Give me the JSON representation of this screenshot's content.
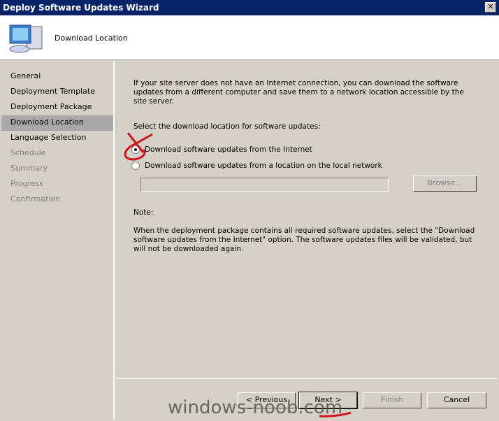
{
  "window": {
    "title": "Deploy Software Updates Wizard",
    "close": "✕"
  },
  "header": {
    "title": "Download Location",
    "icon": "computer-icon"
  },
  "sidebar": {
    "items": [
      {
        "label": "General",
        "state": "normal"
      },
      {
        "label": "Deployment Template",
        "state": "normal"
      },
      {
        "label": "Deployment Package",
        "state": "normal"
      },
      {
        "label": "Download Location",
        "state": "active"
      },
      {
        "label": "Language Selection",
        "state": "normal"
      },
      {
        "label": "Schedule",
        "state": "disabled"
      },
      {
        "label": "Summary",
        "state": "disabled"
      },
      {
        "label": "Progress",
        "state": "disabled"
      },
      {
        "label": "Confirmation",
        "state": "disabled"
      }
    ]
  },
  "main": {
    "intro": "If your site server does not have an Internet connection, you can download the software updates from a different computer and save them to a network location accessible by the site server.",
    "select_label": "Select the download location for software updates:",
    "option_internet": "Download software updates from the Internet",
    "option_network": "Download software updates from a location on the local network",
    "selected": "internet",
    "path_value": "",
    "browse": "Browse...",
    "note_label": "Note:",
    "note_text": "When the deployment package contains all required software updates, select the \"Download software updates from the Internet\" option. The software updates files will be validated, but will not be downloaded again."
  },
  "buttons": {
    "previous": "< Previous",
    "next": "Next >",
    "finish": "Finish",
    "cancel": "Cancel"
  },
  "watermark": "windows-noob.com",
  "annotation_color": "#d0141c"
}
